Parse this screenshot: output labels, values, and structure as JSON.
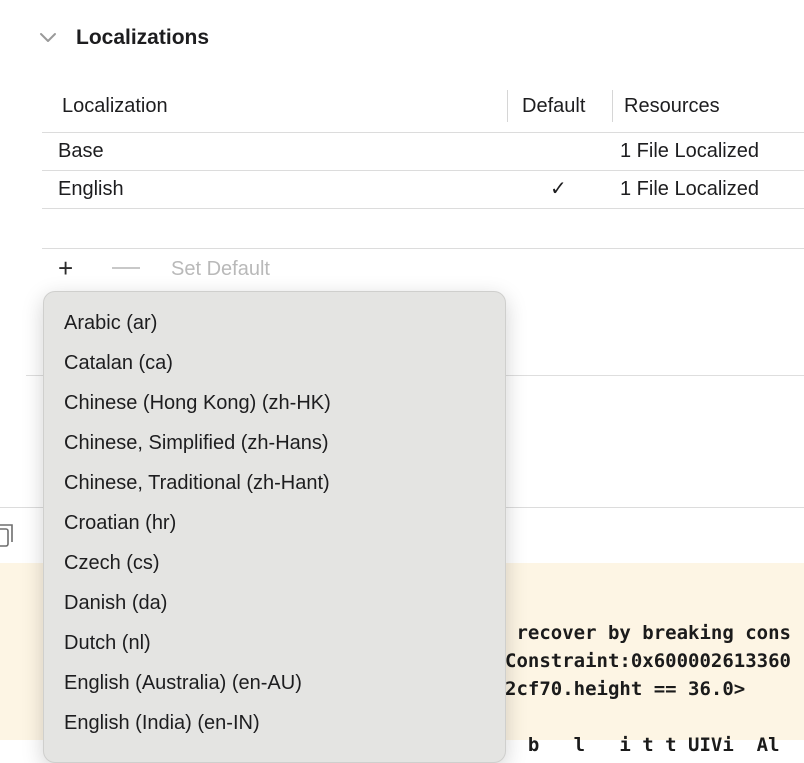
{
  "section": {
    "title": "Localizations",
    "chevron_icon": "chevron-down-icon"
  },
  "table": {
    "headers": {
      "localization": "Localization",
      "default": "Default",
      "resources": "Resources"
    },
    "rows": [
      {
        "localization": "Base",
        "default": "",
        "resources": "1 File Localized"
      },
      {
        "localization": "English",
        "default": "✓",
        "resources": "1 File Localized"
      }
    ]
  },
  "toolbar": {
    "add_label": "+",
    "set_default_label": "Set Default"
  },
  "console": {
    "copy_icon": "copy-icon",
    "lines": [
      " recover by breaking cons",
      "Constraint:0x600002613360",
      "2cf70.height == 36.0>",
      "",
      "  b   l   i t t UIVi  Al"
    ]
  },
  "popup_menu": {
    "items": [
      "Arabic (ar)",
      "Catalan (ca)",
      "Chinese (Hong Kong) (zh-HK)",
      "Chinese, Simplified (zh-Hans)",
      "Chinese, Traditional (zh-Hant)",
      "Croatian (hr)",
      "Czech (cs)",
      "Danish (da)",
      "Dutch (nl)",
      "English (Australia) (en-AU)",
      "English (India) (en-IN)"
    ]
  }
}
